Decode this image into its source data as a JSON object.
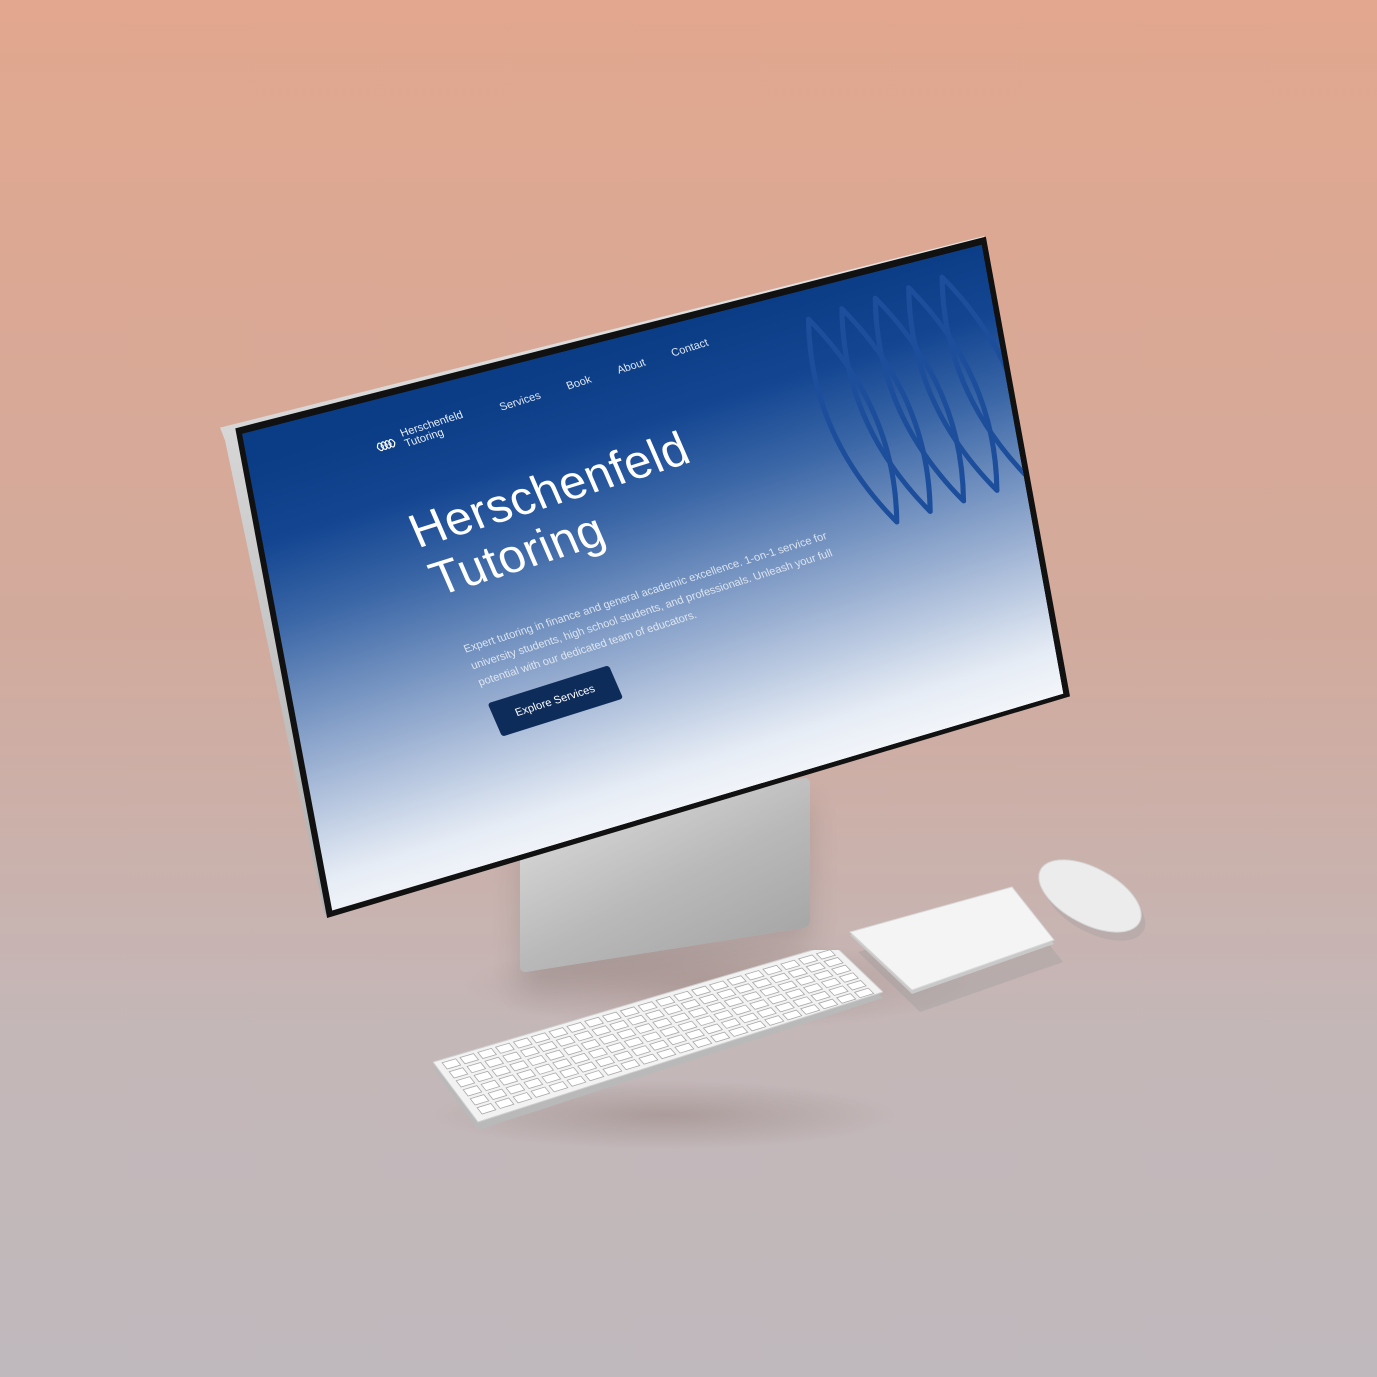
{
  "site": {
    "logo": {
      "line1": "Herschenfeld",
      "line2": "Tutoring"
    },
    "nav": [
      "Services",
      "Book",
      "About",
      "Contact"
    ],
    "hero": {
      "title_line1": "Herschenfeld",
      "title_line2": "Tutoring",
      "subtitle": "Expert tutoring in finance and general academic excellence. 1-on-1 service for university students, high school students, and professionals. Unleash your full potential with our dedicated team of educators.",
      "cta": "Explore Services"
    },
    "colors": {
      "primary": "#0b3d86",
      "button": "#0e2c5a",
      "graphic": "#1d4e9b"
    }
  },
  "scene": {
    "background_top": "#e2a78e",
    "background_bottom": "#bfb8bc",
    "devices": [
      "monitor",
      "keyboard",
      "trackpad",
      "mouse"
    ]
  }
}
